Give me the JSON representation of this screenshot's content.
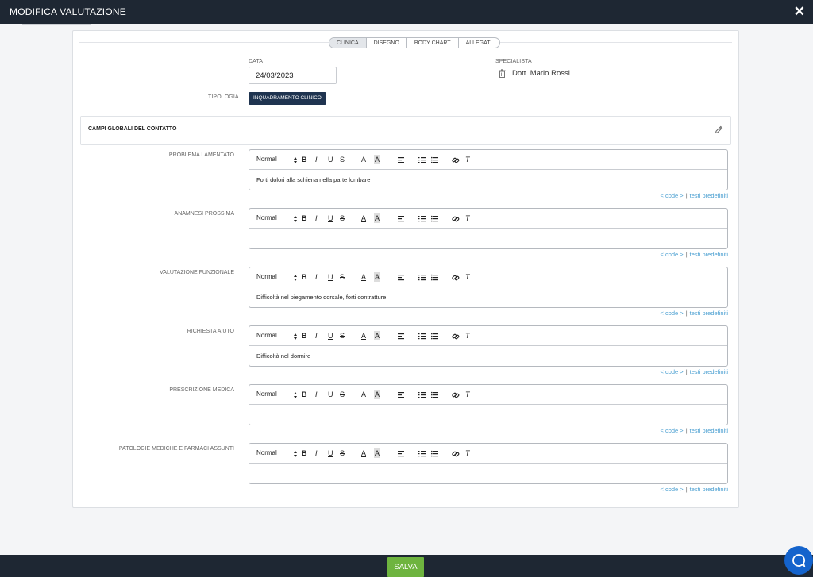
{
  "header": {
    "title": "MODIFICA VALUTAZIONE",
    "close_icon": "close-icon"
  },
  "tabs": [
    {
      "label": "CLINICA",
      "active": true
    },
    {
      "label": "DISEGNO",
      "active": false
    },
    {
      "label": "BODY CHART",
      "active": false
    },
    {
      "label": "ALLEGATI",
      "active": false
    }
  ],
  "form": {
    "date_label": "DATA",
    "date_value": "24/03/2023",
    "specialist_label": "SPECIALISTA",
    "specialist_value": "Dott. Mario Rossi",
    "type_label": "TIPOLOGIA",
    "type_value": "INQUADRAMENTO CLINICO"
  },
  "global_fields": {
    "title": "CAMPI GLOBALI DEL CONTATTO"
  },
  "editor_toolbar": {
    "format_label": "Normal",
    "bold": "B",
    "italic": "I",
    "underline": "U",
    "strike": "S",
    "color": "A",
    "background": "A",
    "clear": "T"
  },
  "links": {
    "code": "< code >",
    "separator": "|",
    "templates": "testi predefiniti"
  },
  "fields": [
    {
      "label": "PROBLEMA LAMENTATO",
      "content": "Forti dolori alla schiena nella parte lombare"
    },
    {
      "label": "ANAMNESI PROSSIMA",
      "content": ""
    },
    {
      "label": "VALUTAZIONE FUNZIONALE",
      "content": "Difficoltà nel piegamento dorsale, forti contratture"
    },
    {
      "label": "RICHIESTA AIUTO",
      "content": "Difficoltà nel dormire"
    },
    {
      "label": "PRESCRIZIONE MEDICA",
      "content": ""
    },
    {
      "label": "PATOLOGIE MEDICHE E FARMACI ASSUNTI",
      "content": ""
    }
  ],
  "footer": {
    "save_label": "SALVA"
  },
  "colors": {
    "topbar": "#1e2733",
    "save": "#6eb43f",
    "link": "#4a9fd1",
    "chip": "#1f3450",
    "chat": "#1463cc"
  }
}
